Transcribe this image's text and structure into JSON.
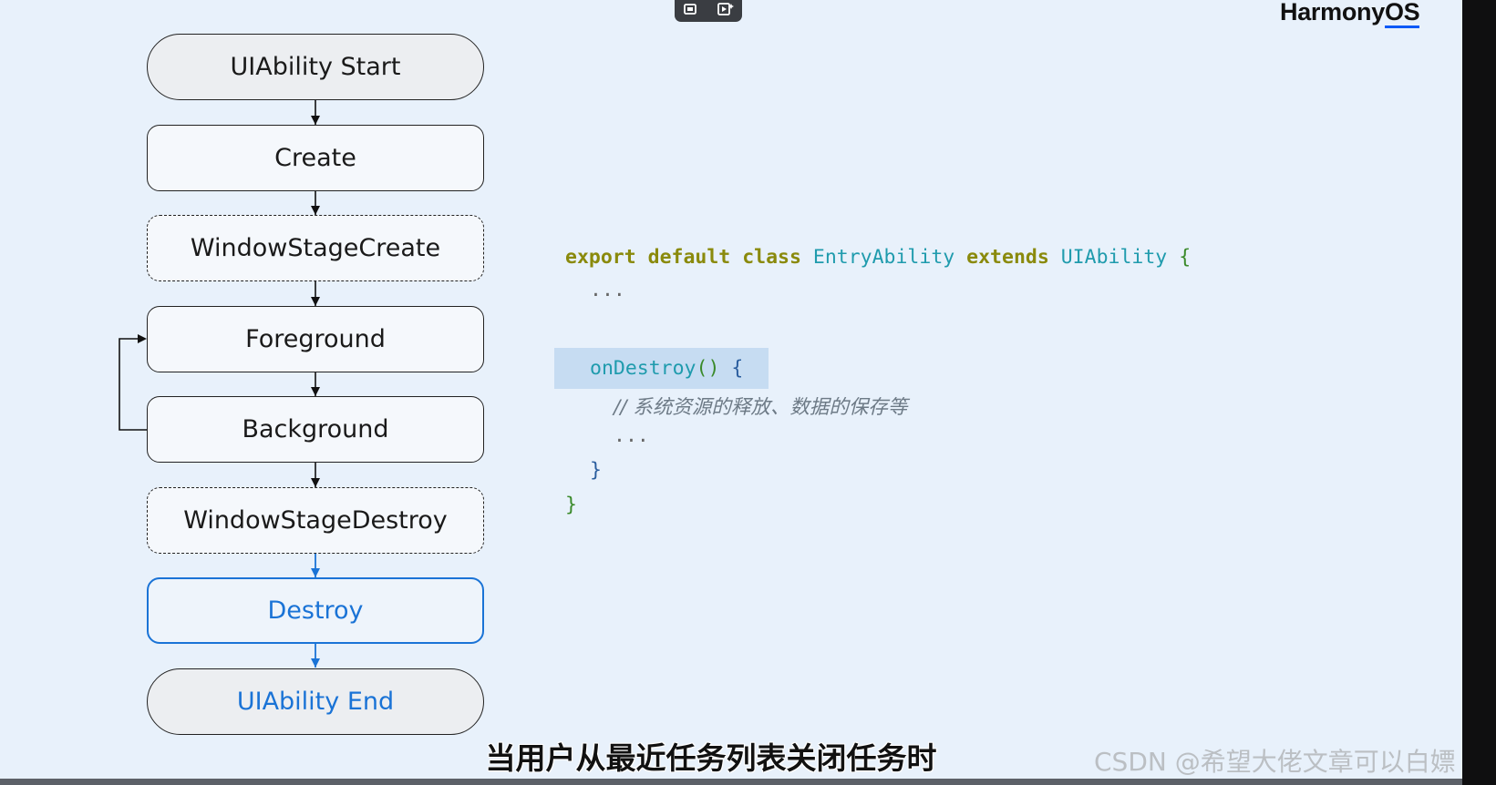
{
  "brand": {
    "text_main": "Harmony",
    "text_os": "OS"
  },
  "video_controls": {
    "icons": [
      "screenshot-icon",
      "record-icon"
    ]
  },
  "flowchart": {
    "nodes": [
      {
        "id": "start",
        "label": "UIAbility Start"
      },
      {
        "id": "create",
        "label": "Create"
      },
      {
        "id": "window-stage-create",
        "label": "WindowStageCreate"
      },
      {
        "id": "foreground",
        "label": "Foreground"
      },
      {
        "id": "background",
        "label": "Background"
      },
      {
        "id": "window-stage-destroy",
        "label": "WindowStageDestroy"
      },
      {
        "id": "destroy",
        "label": "Destroy"
      },
      {
        "id": "end",
        "label": "UIAbility End"
      }
    ],
    "highlight_color": "#1a73d6"
  },
  "code": {
    "line1": {
      "kw1": "export",
      "kw2": "default",
      "kw3": "class",
      "cls": "EntryAbility",
      "kw4": "extends",
      "base": "UIAbility",
      "brace": "{"
    },
    "line2": "...",
    "line3": {
      "fn": "onDestroy",
      "parens": "()",
      "brace": "{"
    },
    "line4": "// 系统资源的释放、数据的保存等",
    "line5": "...",
    "line6": "}",
    "line7": "}"
  },
  "subtitle": "当用户从最近任务列表关闭任务时",
  "watermark": "CSDN @希望大佬文章可以白嫖"
}
